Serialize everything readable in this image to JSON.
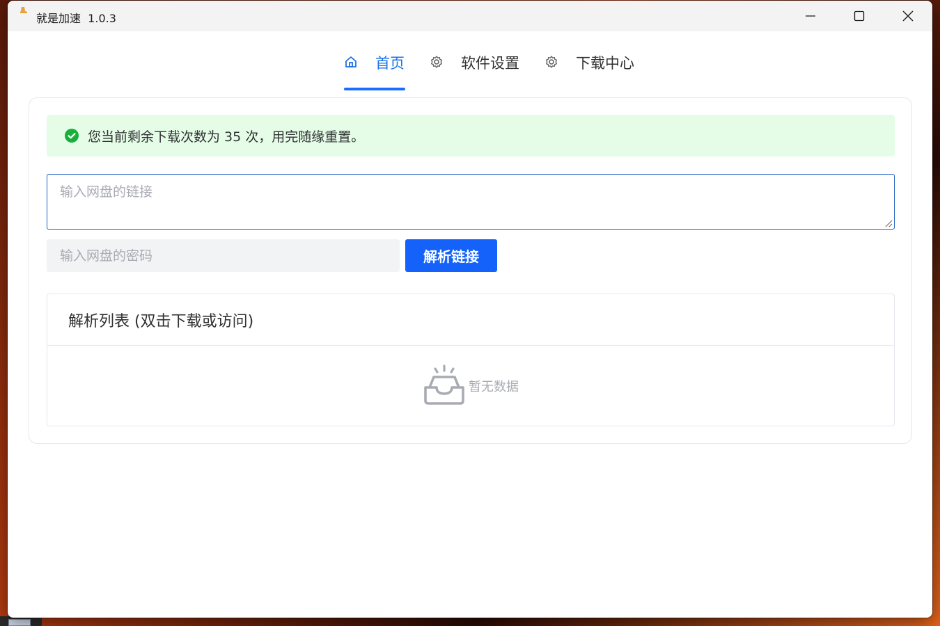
{
  "window": {
    "title": "就是加速  1.0.3"
  },
  "nav": {
    "tabs": [
      {
        "label": "首页",
        "icon": "home-icon",
        "active": true
      },
      {
        "label": "软件设置",
        "icon": "gear-icon",
        "active": false
      },
      {
        "label": "下载中心",
        "icon": "gear-icon",
        "active": false
      }
    ]
  },
  "alert": {
    "message": "您当前剩余下载次数为 35 次，用完随缘重置。",
    "icon": "check-circle-icon"
  },
  "form": {
    "link_placeholder": "输入网盘的链接",
    "link_value": "",
    "password_placeholder": "输入网盘的密码",
    "password_value": "",
    "parse_button": "解析链接"
  },
  "list": {
    "title": "解析列表 (双击下载或访问)",
    "empty_text": "暂无数据",
    "items": []
  },
  "colors": {
    "accent": "#1462fa",
    "alert_bg": "#e5fde7",
    "success": "#17b03a"
  }
}
